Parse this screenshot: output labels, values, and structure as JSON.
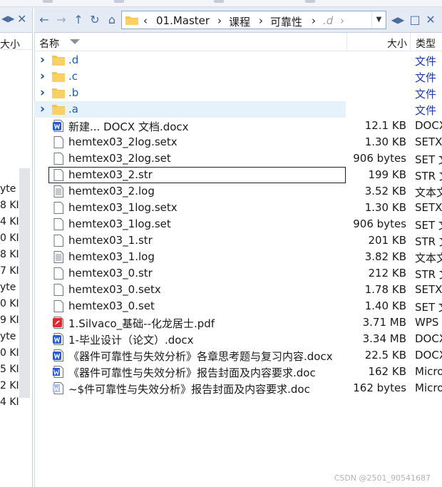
{
  "left_pane": {
    "col_header": "大小",
    "rows": [
      "",
      "",
      "",
      "",
      "",
      "",
      "",
      "",
      "yte",
      "8 KI",
      "4 KI",
      "0 KI",
      "8 KI",
      "7 KI",
      "yte",
      "0 KI",
      "9 KI",
      "yte",
      "0 KI",
      "5 KI",
      "2 KI",
      "4 KI"
    ]
  },
  "address": {
    "segments": [
      "01.Master",
      "课程",
      "可靠性",
      ".d"
    ],
    "separator": "›"
  },
  "columns": {
    "name": "名称",
    "size": "大小",
    "type": "类型"
  },
  "files": [
    {
      "name": ".d",
      "size": "",
      "type": "文件",
      "kind": "folder"
    },
    {
      "name": ".c",
      "size": "",
      "type": "文件",
      "kind": "folder"
    },
    {
      "name": ".b",
      "size": "",
      "type": "文件",
      "kind": "folder"
    },
    {
      "name": ".a",
      "size": "",
      "type": "文件",
      "kind": "folder"
    },
    {
      "name": "新建... DOCX 文档.docx",
      "size": "12.1 KB",
      "type": "DOCX",
      "kind": "word"
    },
    {
      "name": "hemtex03_2log.setx",
      "size": "1.30 KB",
      "type": "SETX",
      "kind": "blank"
    },
    {
      "name": "hemtex03_2log.set",
      "size": "906 bytes",
      "type": "SET 文",
      "kind": "blank"
    },
    {
      "name": "hemtex03_2.str",
      "size": "199 KB",
      "type": "STR 文",
      "kind": "blank"
    },
    {
      "name": "hemtex03_2.log",
      "size": "3.52 KB",
      "type": "文本文",
      "kind": "text"
    },
    {
      "name": "hemtex03_1log.setx",
      "size": "1.30 KB",
      "type": "SETX",
      "kind": "blank"
    },
    {
      "name": "hemtex03_1log.set",
      "size": "906 bytes",
      "type": "SET 文",
      "kind": "blank"
    },
    {
      "name": "hemtex03_1.str",
      "size": "201 KB",
      "type": "STR 文",
      "kind": "blank"
    },
    {
      "name": "hemtex03_1.log",
      "size": "3.82 KB",
      "type": "文本文",
      "kind": "text"
    },
    {
      "name": "hemtex03_0.str",
      "size": "212 KB",
      "type": "STR 文",
      "kind": "blank"
    },
    {
      "name": "hemtex03_0.setx",
      "size": "1.78 KB",
      "type": "SETX",
      "kind": "blank"
    },
    {
      "name": "hemtex03_0.set",
      "size": "1.40 KB",
      "type": "SET 文",
      "kind": "blank"
    },
    {
      "name": "1.Silvaco_基础--化龙居士.pdf",
      "size": "3.71 MB",
      "type": "WPS",
      "kind": "pdf"
    },
    {
      "name": "1-毕业设计（论文）.docx",
      "size": "3.34 MB",
      "type": "DOCX",
      "kind": "word"
    },
    {
      "name": "《器件可靠性与失效分析》各章思考题与复习内容.docx",
      "size": "22.5 KB",
      "type": "DOCX",
      "kind": "word"
    },
    {
      "name": "《器件可靠性与失效分析》报告封面及内容要求.doc",
      "size": "162 KB",
      "type": "Micro",
      "kind": "worddoc"
    },
    {
      "name": "~$件可靠性与失效分析》报告封面及内容要求.doc",
      "size": "162 bytes",
      "type": "Micro",
      "kind": "worddoc-light"
    }
  ],
  "watermark": "CSDN @2501_90541687",
  "colors": {
    "folder": "#f3c44f",
    "toolbar": "#e4ebf5",
    "selection": "#e5f1fb",
    "word_blue": "#2a5bd7",
    "pdf_red": "#e0292b"
  }
}
